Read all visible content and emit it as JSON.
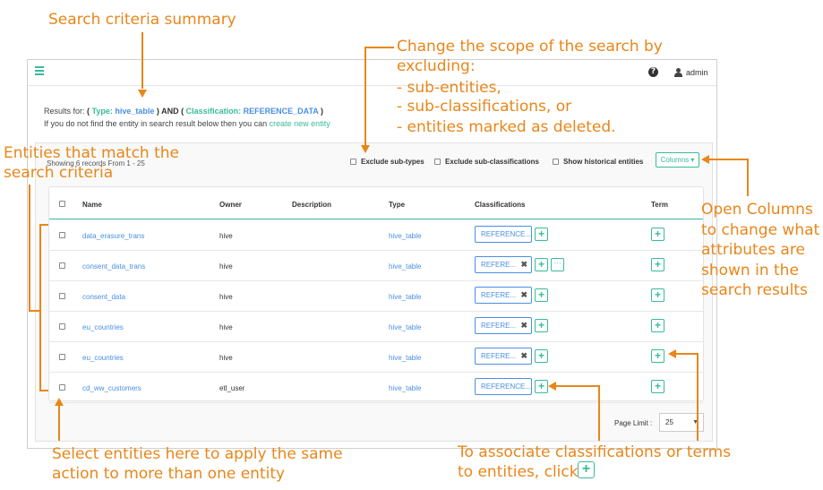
{
  "topbar": {
    "user": "admin",
    "help": "?"
  },
  "results": {
    "prefix": "Results for:",
    "open1": "( ",
    "type_key": "Type:",
    "type_val": "hive_table",
    "mid": " ) AND ( ",
    "class_key": "Classification:",
    "class_val": "REFERENCE_DATA",
    "close": " )",
    "hint_text": "If you do not find the entity in search result below then you can ",
    "hint_link": "create new entity"
  },
  "toolbar": {
    "showing": "Showing 6 records From 1 - 25",
    "exclude_subtypes": "Exclude sub-types",
    "exclude_subclassifications": "Exclude sub-classifications",
    "show_historical": "Show historical entities",
    "columns_label": "Columns ▾"
  },
  "table": {
    "headers": {
      "name": "Name",
      "owner": "Owner",
      "description": "Description",
      "type": "Type",
      "classifications": "Classifications",
      "term": "Term"
    },
    "rows": [
      {
        "name": "data_erasure_trans",
        "owner": "hive",
        "type": "hive_table",
        "tag": "REFERENCE...",
        "removable": false,
        "more": false
      },
      {
        "name": "consent_data_trans",
        "owner": "hive",
        "type": "hive_table",
        "tag": "REFERE...",
        "removable": true,
        "more": true
      },
      {
        "name": "consent_data",
        "owner": "hive",
        "type": "hive_table",
        "tag": "REFERE...",
        "removable": true,
        "more": false
      },
      {
        "name": "eu_countries",
        "owner": "hive",
        "type": "hive_table",
        "tag": "REFERE...",
        "removable": true,
        "more": false
      },
      {
        "name": "eu_countries",
        "owner": "hive",
        "type": "hive_table",
        "tag": "REFERE...",
        "removable": true,
        "more": false
      },
      {
        "name": "cd_ww_customers",
        "owner": "etl_user",
        "type": "hive_table",
        "tag": "REFERENCE...",
        "removable": false,
        "more": false
      }
    ]
  },
  "pagination": {
    "label": "Page Limit :",
    "value": "25"
  },
  "annotations": {
    "summary": "Search criteria summary",
    "scope_lines": [
      "Change the scope of the search by",
      "excluding:",
      "-  sub-entities,",
      "-  sub-classifications, or",
      "-  entities marked as deleted."
    ],
    "entities_lines": [
      "Entities that match the",
      "search criteria"
    ],
    "columns_lines": [
      "Open Columns",
      "to change what",
      "attributes are",
      "shown in the",
      "search results"
    ],
    "select_lines": [
      "Select entities here to apply the same",
      "action to more than one entity"
    ],
    "associate_lines": [
      "To associate classifications or terms",
      "to entities, click"
    ]
  },
  "colors": {
    "accent": "#38bb9b",
    "link": "#4a90e2",
    "annotation": "#e8861a"
  }
}
